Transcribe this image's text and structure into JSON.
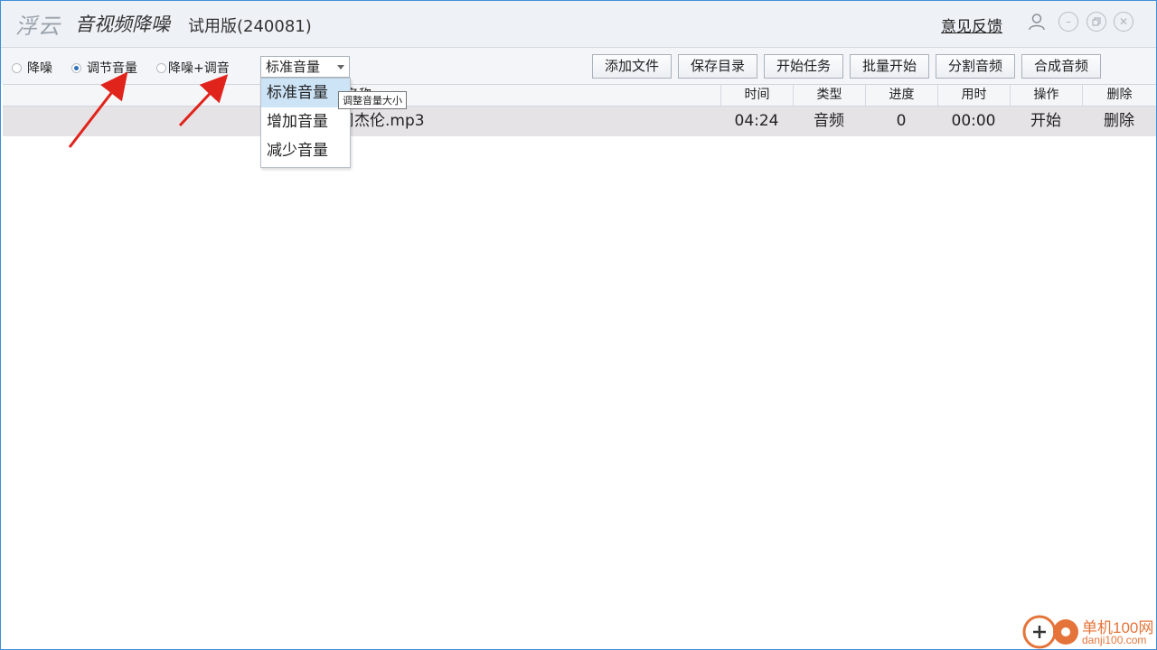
{
  "titlebar": {
    "logo": "浮云",
    "app_name": "音视频降噪",
    "version": "试用版(240081)",
    "feedback": "意见反馈"
  },
  "toolbar": {
    "modes": [
      {
        "label": "降噪",
        "checked": false
      },
      {
        "label": "调节音量",
        "checked": true
      },
      {
        "label": "降噪+调音",
        "checked": false
      }
    ],
    "select_value": "标准音量",
    "buttons": [
      "添加文件",
      "保存目录",
      "开始任务",
      "批量开始",
      "分割音频",
      "合成音频"
    ]
  },
  "dropdown": {
    "options": [
      "标准音量",
      "增加音量",
      "减少音量"
    ],
    "selected_index": 0,
    "tooltip": "调整音量大小"
  },
  "table": {
    "headers": {
      "name": "名称",
      "time": "时间",
      "type": "类型",
      "progress": "进度",
      "elapsed": "用时",
      "action": "操作",
      "delete": "删除"
    },
    "rows": [
      {
        "name": "周杰伦.mp3",
        "time": "04:24",
        "type": "音频",
        "progress": "0",
        "elapsed": "00:00",
        "action": "开始",
        "delete": "删除"
      }
    ]
  },
  "watermark": {
    "line1": "单机100网",
    "line2": "danji100.com"
  },
  "colors": {
    "accent": "#2c6fbf",
    "arrow": "#e0231b",
    "watermark": "#e5743a"
  }
}
